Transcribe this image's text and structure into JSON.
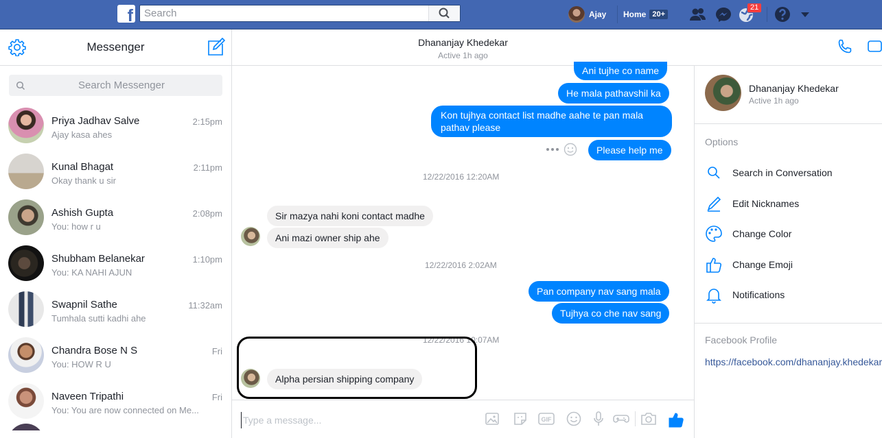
{
  "topbar": {
    "search_placeholder": "Search",
    "user_name": "Ajay",
    "home_label": "Home",
    "home_badge": "20+",
    "notification_count": "21"
  },
  "left": {
    "title": "Messenger",
    "search_placeholder": "Search Messenger",
    "conversations": [
      {
        "name": "Priya Jadhav Salve",
        "snippet": "Ajay kasa ahes",
        "time": "2:15pm"
      },
      {
        "name": "Kunal Bhagat",
        "snippet": "Okay thank u sir",
        "time": "2:11pm"
      },
      {
        "name": "Ashish Gupta",
        "snippet": "You: how r u",
        "time": "2:08pm"
      },
      {
        "name": "Shubham Belanekar",
        "snippet": "You: KA NAHI AJUN",
        "time": "1:10pm"
      },
      {
        "name": "Swapnil Sathe",
        "snippet": "Tumhala sutti kadhi ahe",
        "time": "11:32am"
      },
      {
        "name": "Chandra Bose N S",
        "snippet": "You: HOW R U",
        "time": "Fri"
      },
      {
        "name": "Naveen Tripathi",
        "snippet": "You: You are now connected on Me...",
        "time": "Fri"
      }
    ]
  },
  "chat": {
    "contact_name": "Dhananjay Khedekar",
    "active_status": "Active 1h ago",
    "messages": {
      "m1": "Ani tujhe co name",
      "m2": "He mala pathavshil ka",
      "m3_line1": "Kon tujhya contact list madhe aahe te pan mala",
      "m3_line2": "pathav please",
      "m4": "Please help me",
      "stamp1": "12/22/2016 12:20AM",
      "m5": "Sir mazya nahi koni contact madhe",
      "m6": "Ani mazi owner ship ahe",
      "stamp2": "12/22/2016 2:02AM",
      "m7": "Pan company nav sang mala",
      "m8": "Tujhya co che nav sang",
      "stamp3": "12/22/2016 10:07AM",
      "m9": "Alpha persian shipping company"
    },
    "composer_placeholder": "Type a message..."
  },
  "right": {
    "name": "Dhananjay Khedekar",
    "active_status": "Active 1h ago",
    "options_title": "Options",
    "options": [
      "Search in Conversation",
      "Edit Nicknames",
      "Change Color",
      "Change Emoji",
      "Notifications"
    ],
    "profile_title": "Facebook Profile",
    "profile_link": "https://facebook.com/dhananjay.khedekar"
  },
  "colors": {
    "brand": "#4267b2",
    "messenger_blue": "#0084ff",
    "link": "#365899"
  }
}
